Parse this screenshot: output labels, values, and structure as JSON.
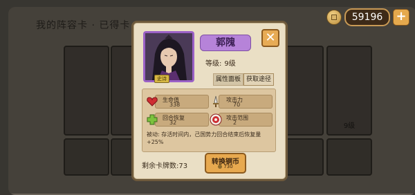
{
  "background": {
    "title": "我的阵容卡 · 已得卡",
    "card_labels": [
      "",
      "",
      "",
      "等级",
      "9级",
      ""
    ]
  },
  "currency": {
    "amount": "59196",
    "icon": "copper-coin-icon",
    "add_icon": "plus-icon"
  },
  "hero": {
    "name": "郭隗",
    "level_label": "等级:",
    "level_value": "9级",
    "rarity": "史诗",
    "colors": {
      "portrait_border": "#9b61c7",
      "name_plate": "#b683d9"
    }
  },
  "tabs": [
    {
      "label": "属性面板",
      "active": true
    },
    {
      "label": "获取途径",
      "active": false
    }
  ],
  "stats": [
    {
      "label": "生命值",
      "value": "338",
      "icon": "heart-icon"
    },
    {
      "label": "攻击力",
      "value": "70",
      "icon": "sword-icon"
    },
    {
      "label": "回合恢复",
      "value": "32",
      "icon": "plus-cross-icon"
    },
    {
      "label": "攻击范围",
      "value": "2",
      "icon": "target-icon"
    }
  ],
  "passive_text": "被动: 存活时间内，己国势力回合结束后恢复量+25%",
  "remaining_label": "剩余卡牌数:",
  "remaining_value": "73",
  "convert": {
    "label": "转换铜币",
    "cost": "730"
  }
}
